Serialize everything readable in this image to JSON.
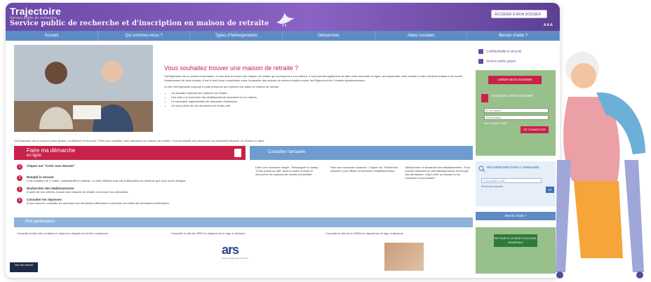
{
  "brand": {
    "name": "Trajectoire",
    "tagline": "Service public de recherche"
  },
  "header": {
    "site_title": "Service public de recherche et d'inscription en maison de retraite",
    "access_button": "ACCÉDER À MON DOSSIER",
    "text_size": "A A A"
  },
  "nav": [
    "Accueil",
    "Qui sommes-nous ?",
    "Types d'hébergements",
    "Démarches",
    "Aides sociales",
    "Besoin d'aide ?"
  ],
  "intro": {
    "title": "Vous souhaitez trouver une maison de retraite ?",
    "p1": "ViaTrajectoire est un portail d'orientation. Il vous aide à trouver une maison de retraite qui correspond à vos critères. Il vous permet également de faire votre demande en ligne, de transmettre votre dossier à votre médecin traitant et de suivre l'avancement de votre dossier. Il est le fruit d'une coopération entre l'ensemble des acteurs du secteur médico-social, les Régions et les Conseils départementaux.",
    "p2": "Le site ViaTrajectoire propose à toute personne qui cherche une place en maison de retraite :",
    "bullets": [
      "Un annuaire national des maisons de retraite,",
      "Une aide à la recherche des établissements répondant à vos critères,",
      "Le formulaire réglementaire de demande d'admission,",
      "Un suivi précis de vos demandes en temps réel."
    ]
  },
  "note": "ViaTrajectoire est un service public gratuit, confidentiel et sécurisé. Porté pour simplifier votre admission en maison de retraite, il est accessible aux personnes qui souhaitent déposer un dossier en ligne.",
  "demarche": {
    "title": "Faire ma démarche",
    "subtitle": "en ligne",
    "steps": [
      {
        "num": "1",
        "title": "Cliquer sur \"Créer mon dossier\"",
        "text": ""
      },
      {
        "num": "2",
        "title": "Remplir le dossier",
        "text": "Il est constitué de 3 volets : administratif et médical. Le volet médical sera mis à disposition du médecin que vous aurez désigné."
      },
      {
        "num": "3",
        "title": "Rechercher des établissements",
        "text": "À partir de vos critères, trouver des maisons de retraite et envoyer vos demandes."
      },
      {
        "num": "4",
        "title": "Consulter les réponses",
        "text": "À tout moment, consulter les réponses aux demandes effectuées et procéder au retrait des demandes d'admission."
      }
    ]
  },
  "annuaire": {
    "title": "Consulter l'annuaire",
    "cols": [
      "Faire une recherche simple : Renseigner le champ \"Code postal ou ville\" dans le cadre à droite et découvrez les maisons de retraite à proximité.",
      "Faire une recherche avancée : Cliquer sur \"Recherche avancée\" pour affiner la recherche d'établissements.",
      "Sélectionner et demander des établissements : Pour pouvoir sélectionner des établissements et envoyer des demandes, il faut créer un dossier ou se connecter à son dossier."
    ]
  },
  "partners": {
    "title": "Nos partenaires",
    "items": [
      "Consulter la liste des contacts en région en cliquant sur le lien ci-dessous",
      "Consulter le site de l'ARS en cliquant sur le logo ci-dessous",
      "Consulter le site de la CNSA en cliquant sur le logo ci-dessous"
    ],
    "ars_logo": "ars",
    "ars_sub": "Agence Régionale de Santé"
  },
  "sidebar": {
    "links": [
      "Confidentialité et sécurité",
      "Service public gratuit"
    ],
    "create_button": "CRÉER MON DOSSIER",
    "login_title": "ACCÉDER À MON DOSSIER",
    "id_placeholder": "N° de dossier",
    "pwd_placeholder": "Mot de passe",
    "forgot": "Mot de passe oublié ?",
    "login_button": "SE CONNECTER",
    "search_title": "RECHERCHER DANS L'ANNUAIRE",
    "search_placeholder": "Code postal ou ville",
    "advanced": "Recherche avancée",
    "ok": "OK",
    "help": "Besoin d'aide ?",
    "return_button": "RETOUR À LA PAGE D'ACCUEIL GÉNÉRALE"
  },
  "badge": "Mon site internet"
}
